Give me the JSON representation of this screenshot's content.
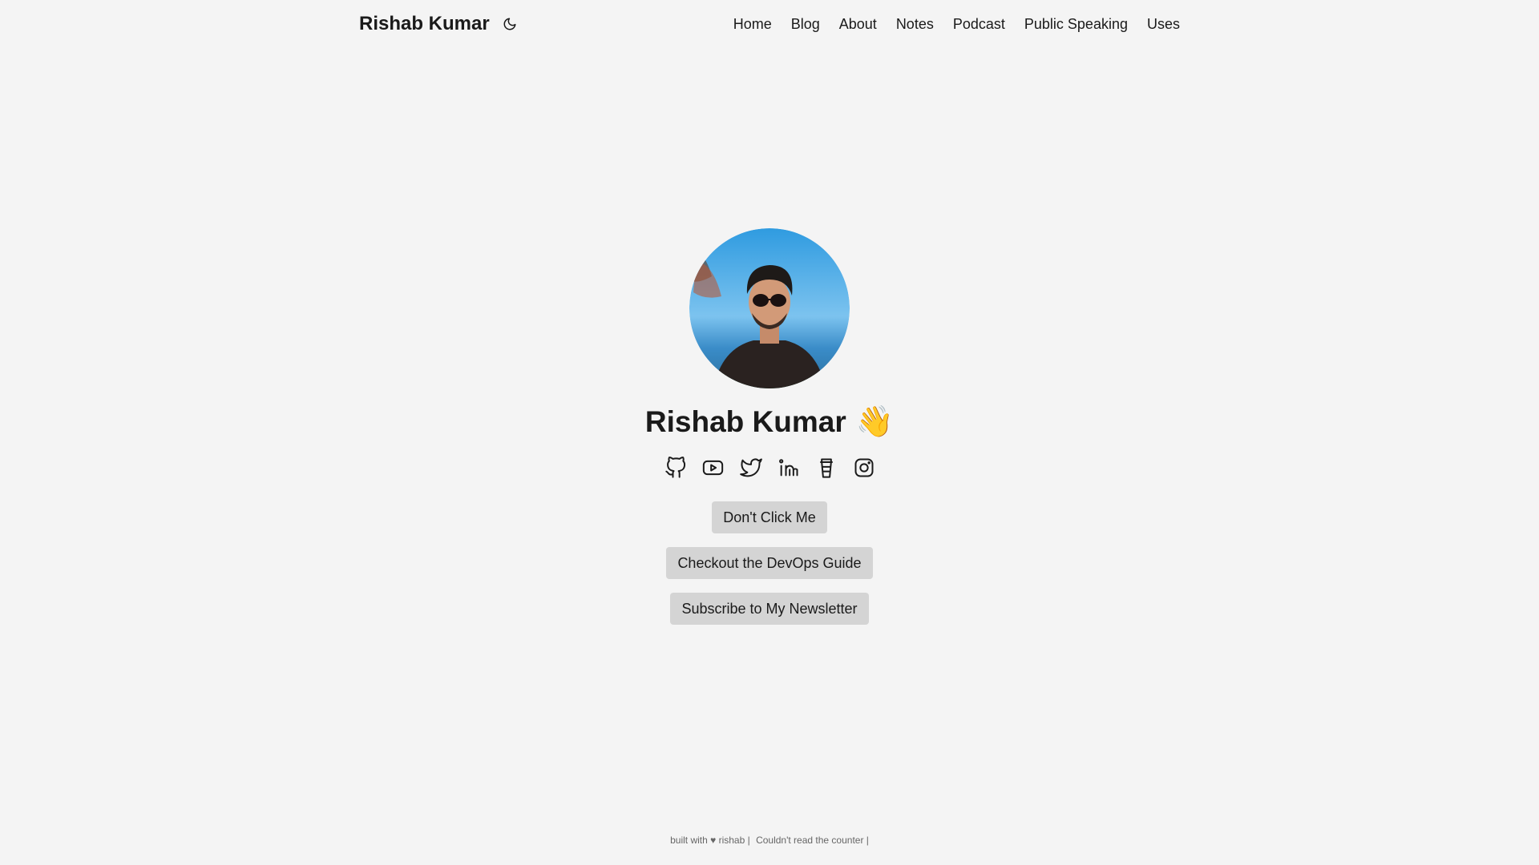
{
  "header": {
    "brand": "Rishab Kumar",
    "theme_icon": "moon-icon",
    "nav": [
      {
        "label": "Home"
      },
      {
        "label": "Blog"
      },
      {
        "label": "About"
      },
      {
        "label": "Notes"
      },
      {
        "label": "Podcast"
      },
      {
        "label": "Public Speaking"
      },
      {
        "label": "Uses"
      }
    ]
  },
  "hero": {
    "name": "Rishab Kumar",
    "wave": "👋",
    "socials": [
      {
        "icon": "github-icon"
      },
      {
        "icon": "youtube-icon"
      },
      {
        "icon": "twitter-icon"
      },
      {
        "icon": "linkedin-icon"
      },
      {
        "icon": "coffee-icon"
      },
      {
        "icon": "instagram-icon"
      }
    ],
    "buttons": [
      {
        "label": "Don't Click Me"
      },
      {
        "label": "Checkout the DevOps Guide"
      },
      {
        "label": "Subscribe to My Newsletter"
      }
    ]
  },
  "footer": {
    "credit": "built with ♥ rishab |",
    "counter": "Couldn't read the counter |"
  },
  "colors": {
    "background": "#f4f4f4",
    "button": "#d4d4d4",
    "text": "#1a1a1a"
  }
}
